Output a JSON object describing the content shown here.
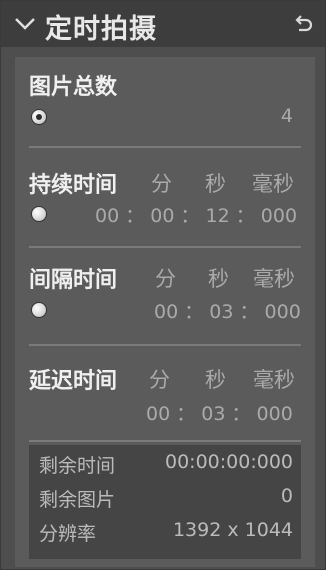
{
  "header": {
    "title": "定时拍摄"
  },
  "total_pictures": {
    "label": "图片总数",
    "value": "4"
  },
  "units": {
    "min": "分",
    "sec": "秒",
    "ms": "毫秒"
  },
  "duration": {
    "label": "持续时间",
    "value": "00 ： 00 ： 12 ： 000"
  },
  "interval": {
    "label": "间隔时间",
    "value": "00 ： 03 ： 000"
  },
  "delay": {
    "label": "延迟时间",
    "value": "00 ： 03 ： 000"
  },
  "info": {
    "remaining_time": {
      "label": "剩余时间",
      "value": "00:00:00:000"
    },
    "remaining_pictures": {
      "label": "剩余图片",
      "value": "0"
    },
    "resolution": {
      "label": "分辨率",
      "value": "1392 x 1044"
    }
  },
  "icons": {
    "collapse": "chevron-down-icon",
    "reset": "undo-icon"
  }
}
